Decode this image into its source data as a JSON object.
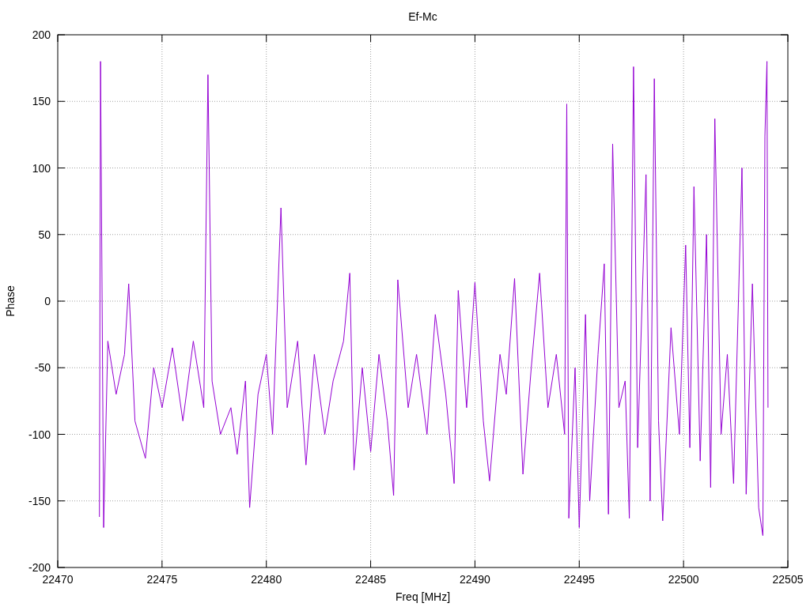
{
  "chart_data": {
    "type": "line",
    "title": "Ef-Mc",
    "xlabel": "Freq [MHz]",
    "ylabel": "Phase",
    "grid": true,
    "xlim": [
      22470,
      22505
    ],
    "ylim": [
      -200,
      200
    ],
    "xticks": [
      22470,
      22475,
      22480,
      22485,
      22490,
      22495,
      22500,
      22505
    ],
    "yticks": [
      -200,
      -150,
      -100,
      -50,
      0,
      50,
      100,
      150,
      200
    ],
    "x": [
      22472.0,
      22472.05,
      22472.2,
      22472.4,
      22472.8,
      22473.2,
      22473.4,
      22473.7,
      22474.2,
      22474.6,
      22475.0,
      22475.5,
      22476.0,
      22476.5,
      22477.0,
      22477.2,
      22477.4,
      22477.8,
      22478.3,
      22478.6,
      22479.0,
      22479.2,
      22479.6,
      22480.0,
      22480.3,
      22480.7,
      22481.0,
      22481.5,
      22481.9,
      22482.3,
      22482.8,
      22483.2,
      22483.7,
      22484.0,
      22484.2,
      22484.6,
      22485.0,
      22485.4,
      22485.8,
      22486.1,
      22486.3,
      22486.8,
      22487.2,
      22487.7,
      22488.1,
      22488.6,
      22489.0,
      22489.2,
      22489.6,
      22490.0,
      22490.4,
      22490.7,
      22491.2,
      22491.5,
      22491.9,
      22492.3,
      22492.7,
      22493.1,
      22493.5,
      22493.9,
      22494.3,
      22494.4,
      22494.5,
      22494.8,
      22495.0,
      22495.3,
      22495.5,
      22495.9,
      22496.2,
      22496.4,
      22496.6,
      22496.9,
      22497.2,
      22497.4,
      22497.6,
      22497.8,
      22498.2,
      22498.4,
      22498.6,
      22498.8,
      22499.0,
      22499.4,
      22499.8,
      22500.1,
      22500.3,
      22500.5,
      22500.8,
      22501.1,
      22501.3,
      22501.5,
      22501.8,
      22502.1,
      22502.4,
      22502.8,
      22503.0,
      22503.3,
      22503.6,
      22503.8,
      22503.9,
      22504.0,
      22504.05
    ],
    "series": [
      {
        "color": "#9400d3",
        "values": [
          -162,
          180,
          -170,
          -30,
          -70,
          -40,
          13,
          -90,
          -118,
          -50,
          -80,
          -35,
          -90,
          -30,
          -80,
          170,
          -60,
          -100,
          -80,
          -115,
          -60,
          -155,
          -70,
          -40,
          -100,
          70,
          -80,
          -30,
          -123,
          -40,
          -100,
          -60,
          -30,
          21,
          -127,
          -50,
          -113,
          -40,
          -90,
          -146,
          16,
          -80,
          -40,
          -100,
          -10,
          -70,
          -137,
          8,
          -80,
          14,
          -90,
          -135,
          -40,
          -70,
          17,
          -130,
          -50,
          21,
          -80,
          -40,
          -100,
          148,
          -163,
          -50,
          -170,
          -10,
          -150,
          -40,
          28,
          -160,
          118,
          -80,
          -60,
          -163,
          176,
          -110,
          95,
          -150,
          167,
          -90,
          -165,
          -20,
          -100,
          42,
          -110,
          86,
          -120,
          50,
          -140,
          137,
          -100,
          -40,
          -137,
          100,
          -145,
          13,
          -155,
          -176,
          124,
          180,
          -80
        ]
      }
    ]
  }
}
